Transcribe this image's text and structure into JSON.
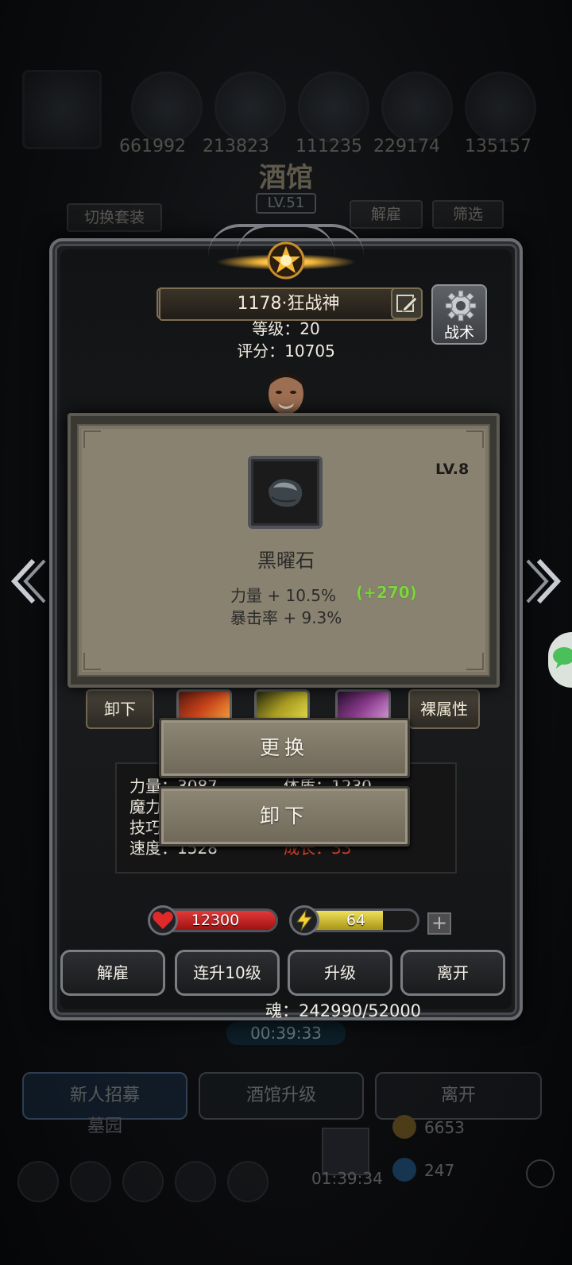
{
  "background": {
    "top_values": [
      "661992",
      "213823",
      "111235",
      "229174",
      "135157"
    ],
    "title": "酒馆",
    "level": "LV.51",
    "switch_outfit": "切换套装",
    "dismiss": "解雇",
    "filter": "筛选",
    "tabs": [
      "新人招募",
      "酒馆升级",
      "离开"
    ],
    "cemetery": "墓园",
    "gold": "6653",
    "gems": "247",
    "timer_top": "00:39:33",
    "timer_bottom": "01:39:34"
  },
  "hero": {
    "name": "1178·狂战神",
    "level_line": "等级：20",
    "score_line": "评分：10705",
    "tactics": "战术"
  },
  "item": {
    "level": "LV.8",
    "name": "黑曜石",
    "stats": [
      "力量 + 10.5%",
      "暴击率 + 9.3%"
    ],
    "bonus": "(+270)"
  },
  "equip_row": {
    "unequip": "卸下",
    "raw_attr": "裸属性"
  },
  "attributes": {
    "labels": [
      "力量：3087",
      "魔力",
      "技巧",
      "速度：1528"
    ],
    "right": [
      "体质：1230",
      "成长：33"
    ]
  },
  "menu": {
    "replace": "更换",
    "unequip": "卸下"
  },
  "bars": {
    "hp": "12300",
    "hp_fraction": 1.0,
    "energy": "64",
    "energy_fraction": 0.72
  },
  "actions": [
    "解雇",
    "连升10级",
    "升级",
    "离开"
  ],
  "soul": "魂：242990/52000",
  "colors": {
    "accent_gold": "#e8b040",
    "bonus_green": "#7ed43e",
    "hp_red": "#c21d1d",
    "energy_yellow": "#d8c52a"
  }
}
